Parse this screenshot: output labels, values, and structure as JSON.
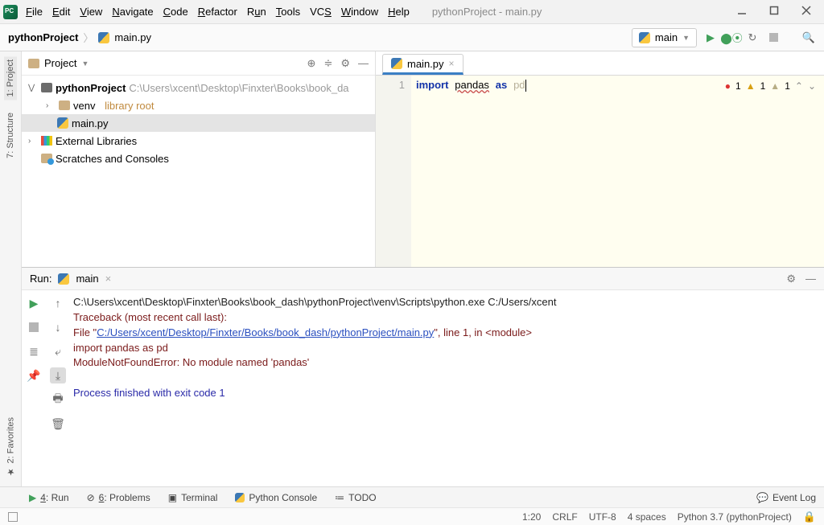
{
  "window": {
    "title": "pythonProject - main.py"
  },
  "menu": {
    "file": "File",
    "edit": "Edit",
    "view": "View",
    "navigate": "Navigate",
    "code": "Code",
    "refactor": "Refactor",
    "run": "Run",
    "tools": "Tools",
    "vcs": "VCS",
    "window": "Window",
    "help": "Help"
  },
  "breadcrumb": {
    "root": "pythonProject",
    "file": "main.py"
  },
  "runconfig": {
    "selected": "main"
  },
  "sidebar": {
    "project": "1: Project",
    "structure": "7: Structure",
    "favorites": "2: Favorites"
  },
  "projpanel": {
    "title": "Project",
    "root": "pythonProject",
    "rootpath": "C:\\Users\\xcent\\Desktop\\Finxter\\Books\\book_da",
    "venv": "venv",
    "venvhint": "library root",
    "mainfile": "main.py",
    "extlib": "External Libraries",
    "scratches": "Scratches and Consoles"
  },
  "editor": {
    "tab": "main.py",
    "lineno": "1",
    "code_kw": "import",
    "code_mod": "pandas",
    "code_as": "as",
    "code_alias": "pd",
    "insp_err": "1",
    "insp_warn": "1",
    "insp_weak": "1"
  },
  "run": {
    "title": "Run:",
    "tab": "main",
    "line1": "C:\\Users\\xcent\\Desktop\\Finxter\\Books\\book_dash\\pythonProject\\venv\\Scripts\\python.exe C:/Users/xcent",
    "tb": "Traceback (most recent call last):",
    "file_pre": "  File \"",
    "file_link": "C:/Users/xcent/Desktop/Finxter/Books/book_dash/pythonProject/main.py",
    "file_post": "\", line 1, in <module>",
    "imp": "    import pandas as pd",
    "err": "ModuleNotFoundError: No module named 'pandas'",
    "exit": "Process finished with exit code 1"
  },
  "bottombar": {
    "run": "4: Run",
    "problems": "6: Problems",
    "terminal": "Terminal",
    "pyconsole": "Python Console",
    "todo": "TODO",
    "eventlog": "Event Log"
  },
  "status": {
    "pos": "1:20",
    "sep": "CRLF",
    "enc": "UTF-8",
    "indent": "4 spaces",
    "sdk": "Python 3.7 (pythonProject)"
  }
}
